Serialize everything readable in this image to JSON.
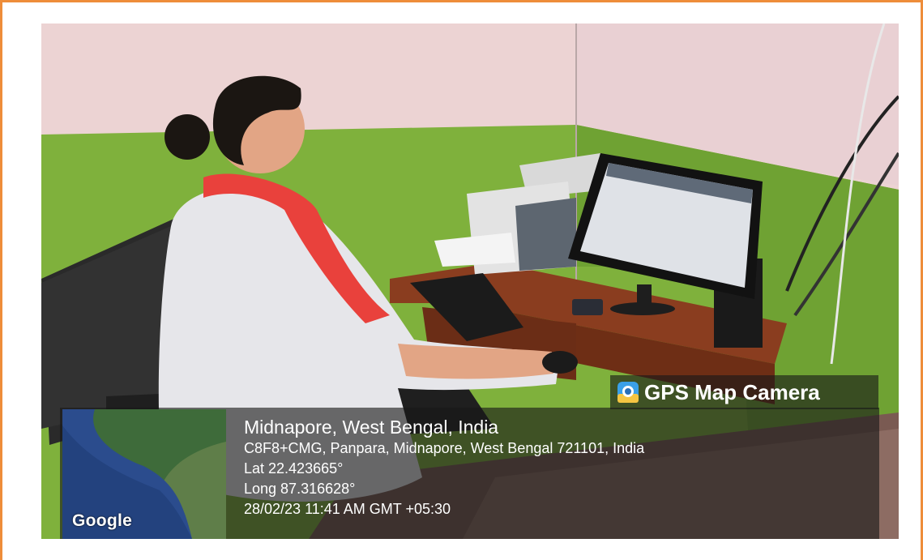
{
  "gps_badge": {
    "label": "GPS Map Camera",
    "icon": "map-camera-icon"
  },
  "map": {
    "attribution": "Google"
  },
  "location": {
    "title": "Midnapore, West Bengal, India",
    "address": "C8F8+CMG, Panpara, Midnapore, West Bengal 721101, India",
    "latitude": "Lat 22.423665°",
    "longitude": "Long 87.316628°",
    "timestamp": "28/02/23 11:41 AM GMT +05:30"
  },
  "colors": {
    "frame_border": "#ee8d3a",
    "wall_pink": "#ecd3d3",
    "wall_green": "#7fb13c",
    "overlay": "#191919"
  }
}
